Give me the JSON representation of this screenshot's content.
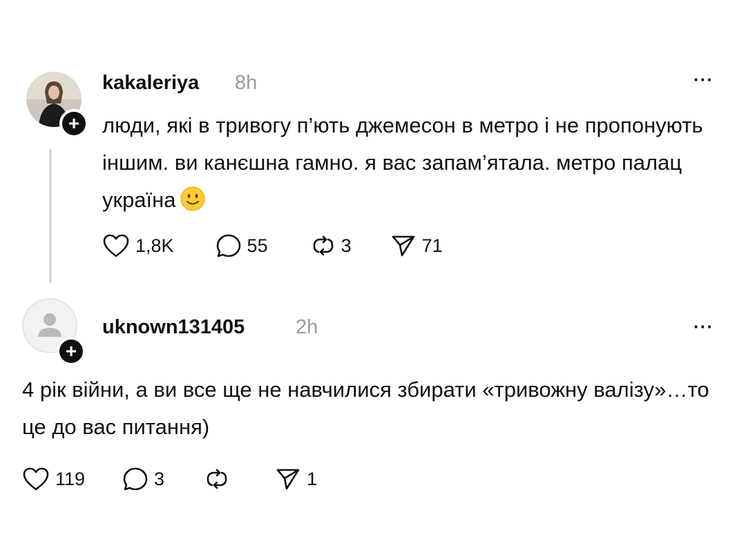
{
  "posts": [
    {
      "username": "kakaleriya",
      "time": "8h",
      "text": "люди, які в тривогу п’ють джемесон в метро і не пропонують іншим. ви канєшна гамно. я вас запам’ятала. метро палац україна",
      "emoji": "slightly-smiling-face",
      "likes": "1,8K",
      "comments": "55",
      "reposts": "3",
      "shares": "71"
    },
    {
      "username": "uknown131405",
      "time": "2h",
      "text": "4 рік війни, а ви все ще не навчилися збирати «тривожну валізу»…то це до вас питання)",
      "likes": "119",
      "comments": "3",
      "reposts": "",
      "shares": "1"
    }
  ],
  "icons": {
    "like": "heart-icon",
    "comment": "comment-icon",
    "repost": "repost-icon",
    "share": "send-icon",
    "more": "more-icon",
    "follow": "plus-icon"
  }
}
